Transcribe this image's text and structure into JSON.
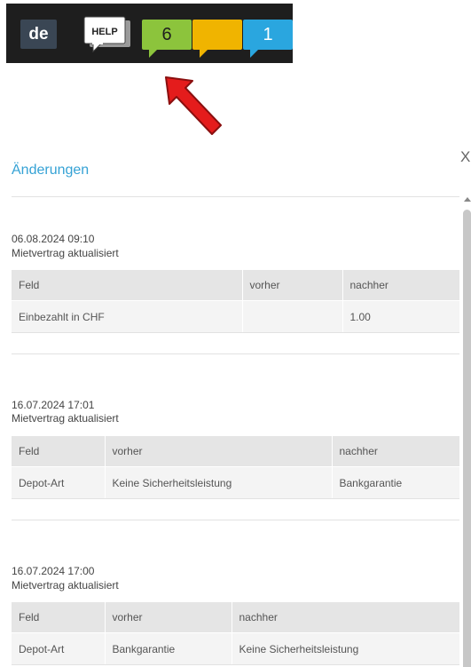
{
  "toolbar": {
    "lang_label": "de",
    "help_label": "HELP",
    "bubbles": [
      {
        "label": "6",
        "color": "#8cc43c"
      },
      {
        "label": "",
        "color": "#f0b400"
      },
      {
        "label": "1",
        "color": "#2aa6df"
      }
    ]
  },
  "panel": {
    "title": "Änderungen",
    "close_label": "X"
  },
  "entries": [
    {
      "datetime": "06.08.2024 09:10",
      "description": "Mietvertrag aktualisiert",
      "headers": [
        "Feld",
        "vorher",
        "nachher"
      ],
      "rows": [
        [
          "Einbezahlt in CHF",
          "",
          "1.00"
        ]
      ]
    },
    {
      "datetime": "16.07.2024 17:01",
      "description": "Mietvertrag aktualisiert",
      "headers": [
        "Feld",
        "vorher",
        "nachher"
      ],
      "rows": [
        [
          "Depot-Art",
          "Keine Sicherheitsleistung",
          "Bankgarantie"
        ]
      ]
    },
    {
      "datetime": "16.07.2024 17:00",
      "description": "Mietvertrag aktualisiert",
      "headers": [
        "Feld",
        "vorher",
        "nachher"
      ],
      "rows": [
        [
          "Depot-Art",
          "Bankgarantie",
          "Keine Sicherheitsleistung"
        ]
      ]
    }
  ]
}
